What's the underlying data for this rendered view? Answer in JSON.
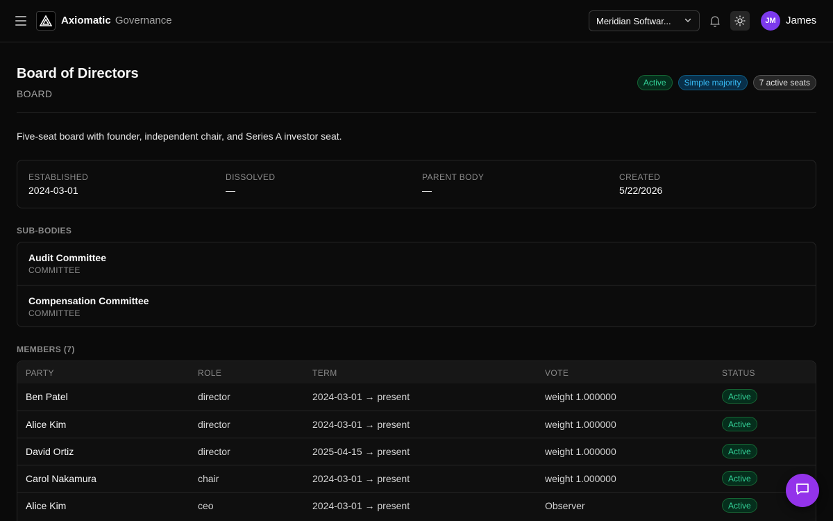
{
  "app": {
    "brand_main": "Axiomatic",
    "brand_sub": "Governance",
    "org_selected": "Meridian Softwar...",
    "user_initials": "JM",
    "user_name": "James"
  },
  "header": {
    "title": "Board of Directors",
    "kind": "BOARD",
    "badges": [
      "Active",
      "Simple majority",
      "7 active seats"
    ],
    "description": "Five-seat board with founder, independent chair, and Series A investor seat."
  },
  "facts": [
    {
      "label": "ESTABLISHED",
      "value": "2024-03-01"
    },
    {
      "label": "DISSOLVED",
      "value": "—"
    },
    {
      "label": "PARENT BODY",
      "value": "—"
    },
    {
      "label": "CREATED",
      "value": "5/22/2026"
    }
  ],
  "sub_bodies": {
    "label": "SUB-BODIES",
    "items": [
      {
        "name": "Audit Committee",
        "type": "COMMITTEE"
      },
      {
        "name": "Compensation Committee",
        "type": "COMMITTEE"
      }
    ]
  },
  "members": {
    "label": "MEMBERS (7)",
    "columns": [
      "PARTY",
      "ROLE",
      "TERM",
      "VOTE",
      "STATUS"
    ],
    "rows": [
      {
        "party": "Ben Patel",
        "role": "director",
        "term": "2024-03-01 → present",
        "vote": "weight 1.000000",
        "status": "Active"
      },
      {
        "party": "Alice Kim",
        "role": "director",
        "term": "2024-03-01 → present",
        "vote": "weight 1.000000",
        "status": "Active"
      },
      {
        "party": "David Ortiz",
        "role": "director",
        "term": "2025-04-15 → present",
        "vote": "weight 1.000000",
        "status": "Active"
      },
      {
        "party": "Carol Nakamura",
        "role": "chair",
        "term": "2024-03-01 → present",
        "vote": "weight 1.000000",
        "status": "Active"
      },
      {
        "party": "Alice Kim",
        "role": "ceo",
        "term": "2024-03-01 → present",
        "vote": "Observer",
        "status": "Active"
      }
    ]
  },
  "icons": {
    "menu": "menu-icon",
    "logo": "triangle-logo-icon",
    "select": "chevron-down-icon",
    "notifications": "bell-icon",
    "theme": "sun-icon",
    "chat": "chat-bubble-icon"
  },
  "colors": {
    "background": "#0a0a0a",
    "active_green": "#34d399",
    "info_blue": "#38bdf8",
    "avatar_purple": "#7c3aed",
    "fab_purple": "#9333ea"
  }
}
